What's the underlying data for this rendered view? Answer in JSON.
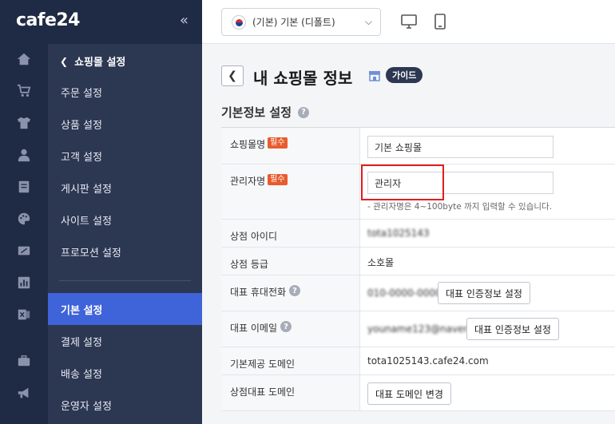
{
  "brand": {
    "logo": "cafe24",
    "collapse_icon": "«"
  },
  "rail_icons": [
    "home-icon",
    "cart-icon",
    "shirt-icon",
    "user-icon",
    "board-icon",
    "palette-icon",
    "promotion-icon",
    "chart-icon",
    "excel-icon",
    "briefcase-icon",
    "megaphone-icon"
  ],
  "submenu": {
    "header": "쇼핑몰 설정",
    "items": [
      "주문 설정",
      "상품 설정",
      "고객 설정",
      "게시판 설정",
      "사이트 설정",
      "프로모션 설정"
    ],
    "items2": [
      "기본 설정",
      "결제 설정",
      "배송 설정",
      "운영자 설정"
    ],
    "active": "기본 설정"
  },
  "topbar": {
    "language": "(기본) 기본 (디폴트)"
  },
  "page": {
    "title": "내 쇼핑몰 정보",
    "guide": "가이드",
    "section": "기본정보 설정",
    "required_badge": "필수"
  },
  "form": {
    "shop_name_label": "쇼핑몰명",
    "shop_name_value": "기본 쇼핑몰",
    "admin_name_label": "관리자명",
    "admin_name_value": "관리자",
    "admin_name_hint": "- 관리자명은 4~100byte 까지 입력할 수 있습니다.",
    "shop_id_label": "상점 아이디",
    "shop_id_value": "tota1025143",
    "shop_grade_label": "상점 등급",
    "shop_grade_value": "소호몰",
    "phone_label": "대표 휴대전화",
    "phone_value": "010-0000-0000",
    "phone_button": "대표 인증정보 설정",
    "email_label": "대표 이메일",
    "email_value": "youname123@naver.com",
    "email_button": "대표 인증정보 설정",
    "domain_label": "기본제공 도메인",
    "domain_value": "tota1025143.cafe24.com",
    "rep_domain_label": "상점대표 도메인",
    "rep_domain_button": "대표 도메인 변경"
  },
  "colors": {
    "sidebar": "#1f2a44",
    "submenu": "#2c3752",
    "active": "#3f63d8",
    "required": "#e85c2e",
    "highlight": "#e11d1d"
  }
}
